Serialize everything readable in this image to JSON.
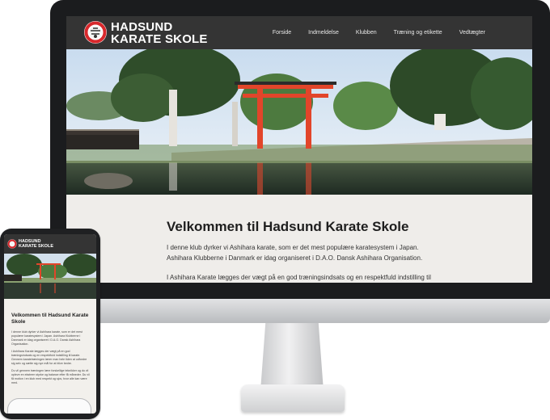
{
  "site": {
    "logo_line1": "HADSUND",
    "logo_line2": "KARATE SKOLE",
    "nav": [
      "Forside",
      "Indmeldelse",
      "Klubben",
      "Træning og etikette",
      "Vedtægter"
    ]
  },
  "content": {
    "title": "Velkommen til Hadsund Karate Skole",
    "paragraph1": "I denne klub dyrker vi Ashihara karate, som er det mest populære karatesystem i Japan. Ashihara Klubberne i Danmark er idag organiseret i D.A.O. Dansk Ashihara Organisation.",
    "paragraph2": "I Ashihara Karate lægges der vægt på en god træningsindsats og en respektfuld indstilling til karate.",
    "paragraph3": "Du vil gennem træningen lære forskellige teknikker og du vil opleve en ekstrem styrke og balance efter få måneder. Du vil få motion i en klub med respekt og sjov, hvor alle kan være med."
  },
  "phone_content": {
    "title": "Velkommen til Hadsund Karate Skole",
    "paragraph1": "I denne klub dyrker vi Ashihara karate, som er det mest populære karatesystem i Japan. Ashihara Klubberne i Danmark er idag organiseret i D.A.O. Dansk Ashihara Organisation.",
    "paragraph2": "I Ashihara Karate lægges der vægt på en god træningsindsats og en respektfuld indstilling til karate. Gennem karatetræningen lærer man hele tiden at udfordre sig selv og sætte sig nye mål for at blive bedre.",
    "paragraph3": "Du vil gennem træningen lære forskellige teknikker og du vil opleve en ekstrem styrke og balance efter få måneder. Du vil få motion i en klub med respekt og sjov, hvor alle kan være med."
  },
  "colors": {
    "header": "#343434",
    "torii": "#e2452a",
    "logo_ring": "#d8282c"
  }
}
